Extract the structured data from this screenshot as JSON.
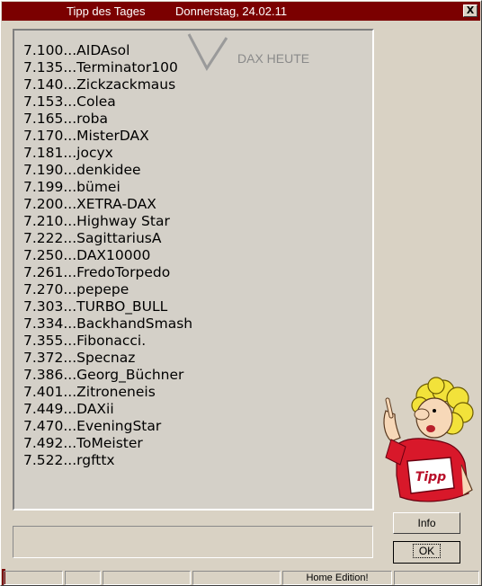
{
  "window": {
    "title_left": "Tipp des Tages",
    "title_right": "Donnerstag, 24.02.11",
    "close_glyph": "X"
  },
  "panel": {
    "label": "DAX HEUTE",
    "entries": [
      "7.100...AIDAsol",
      "7.135...Terminator100",
      "7.140...Zickzackmaus",
      "7.153...Colea",
      "7.165...roba",
      "7.170...MisterDAX",
      "7.181...jocyx",
      "7.190...denkidee",
      "7.199...bümei",
      "7.200...XETRA-DAX",
      "7.210...Highway Star",
      "7.222...SagittariusA",
      "7.250...DAX10000",
      "7.261...FredoTorpedo",
      "7.270...pepepe",
      "7.303...TURBO_BULL",
      "7.334...BackhandSmash",
      "7.355...Fibonacci.",
      "7.372...Specnaz",
      "7.386...Georg_Büchner",
      "7.401...Zitroneneis",
      "7.449...DAXii",
      "7.470...EveningStar",
      "7.492...ToMeister",
      "7.522...rgfttx"
    ]
  },
  "buttons": {
    "info": "Info",
    "ok": "OK"
  },
  "mascot": {
    "shirt_text": "Tipp",
    "icon": "cartoon-mascot-pointing"
  },
  "status": {
    "edition": "Home Edition!"
  },
  "colors": {
    "titlebar": "#7b0000",
    "window": "#d9d2c4",
    "panel": "#d4d0c8",
    "mascot_shirt": "#d8182a",
    "mascot_hair": "#f2e23a"
  }
}
